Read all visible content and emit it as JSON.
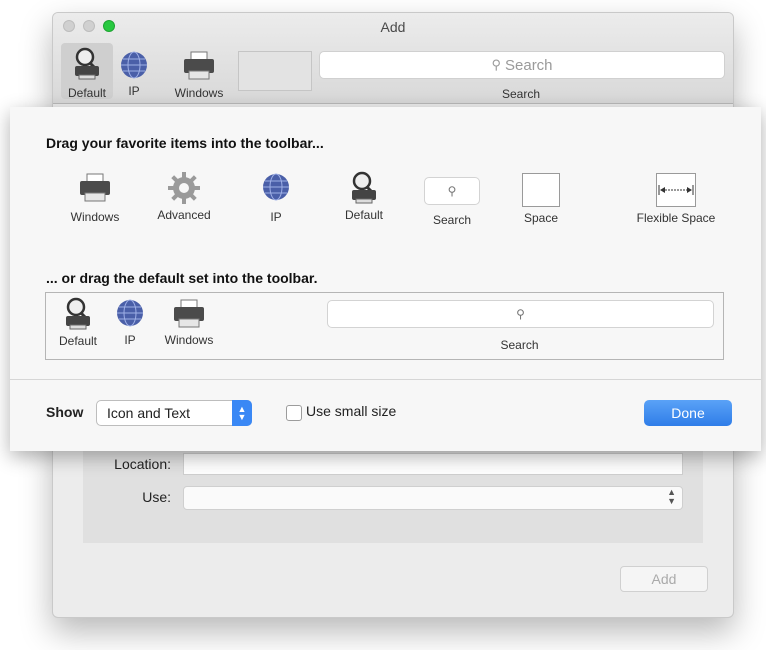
{
  "window": {
    "title": "Add",
    "toolbar": {
      "items": [
        {
          "label": "Default",
          "icon": "magnifier-printer-icon"
        },
        {
          "label": "IP",
          "icon": "globe-icon"
        },
        {
          "label": "Windows",
          "icon": "printer-icon"
        }
      ],
      "search_placeholder": "Search",
      "search_label": "Search"
    },
    "form": {
      "location_label": "Location:",
      "use_label": "Use:",
      "add_button": "Add"
    }
  },
  "customize_sheet": {
    "heading_favorites": "Drag your favorite items into the toolbar...",
    "palette": [
      {
        "label": "Windows",
        "icon": "printer-icon"
      },
      {
        "label": "Advanced",
        "icon": "gear-icon"
      },
      {
        "label": "IP",
        "icon": "globe-icon"
      },
      {
        "label": "Default",
        "icon": "magnifier-printer-icon"
      },
      {
        "label": "Search",
        "icon": "search-field-icon"
      },
      {
        "label": "Space",
        "icon": "space-icon"
      },
      {
        "label": "Flexible Space",
        "icon": "flexible-space-icon"
      }
    ],
    "heading_default": "... or drag the default set into the toolbar.",
    "default_set": {
      "items": [
        {
          "label": "Default"
        },
        {
          "label": "IP"
        },
        {
          "label": "Windows"
        }
      ],
      "search_label": "Search"
    },
    "show_label": "Show",
    "show_value": "Icon and Text",
    "small_size_label": "Use small size",
    "small_size_checked": false,
    "done_label": "Done"
  },
  "colors": {
    "accent": "#3a88f5",
    "traffic_green": "#28c940"
  }
}
